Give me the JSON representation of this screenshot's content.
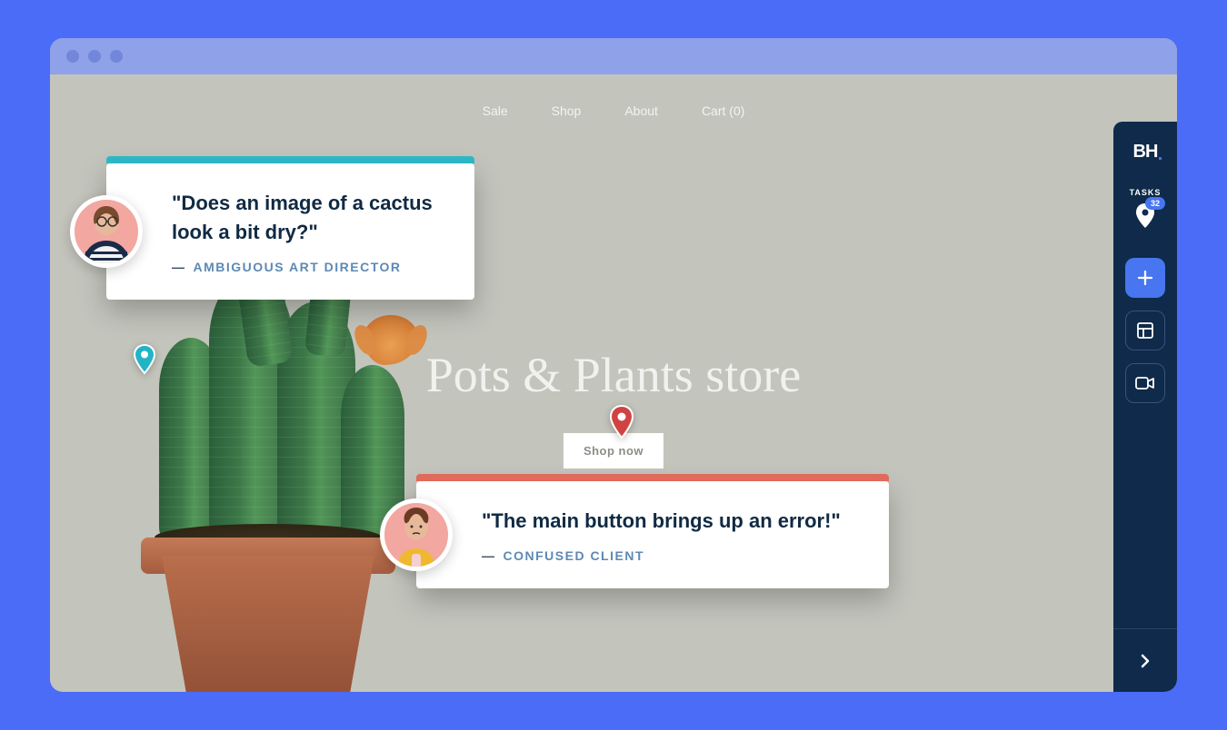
{
  "nav": {
    "items": [
      "Sale",
      "Shop",
      "About",
      "Cart (0)"
    ]
  },
  "hero": {
    "title": "Pots & Plants store",
    "cta": "Shop now"
  },
  "cards": [
    {
      "quote": "\"Does an image of a cactus look a bit dry?\"",
      "attribution": "AMBIGUOUS ART DIRECTOR",
      "bar_color": "#2fb6c4"
    },
    {
      "quote": "\"The main button brings up an error!\"",
      "attribution": "CONFUSED CLIENT",
      "bar_color": "#e06a5c"
    }
  ],
  "sidebar": {
    "logo": "BH",
    "tasks_label": "TASKS",
    "tasks_count": "32"
  },
  "colors": {
    "page_bg": "#4a6cf7",
    "titlebar": "#8fa1e8",
    "viewport": "#c3c4bc",
    "sidebar": "#0f2a4a",
    "accent": "#4876f0"
  }
}
